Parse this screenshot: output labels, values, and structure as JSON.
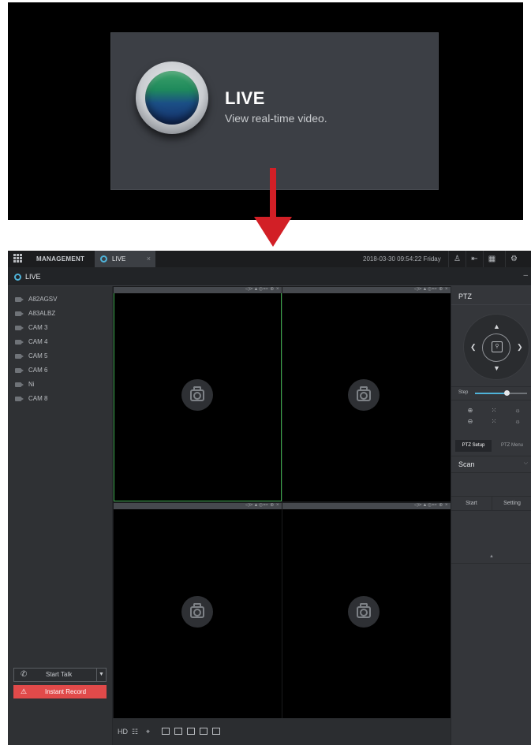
{
  "promo": {
    "title": "LIVE",
    "subtitle": "View real-time video."
  },
  "topbar": {
    "management_label": "MANAGEMENT",
    "live_tab_label": "LIVE",
    "tab_close": "×",
    "datetime": "2018-03-30 09:54:22 Friday"
  },
  "subbar": {
    "title": "LIVE",
    "minimize": "–"
  },
  "cameras": [
    "A82AGSV",
    "A83ALBZ",
    "CAM 3",
    "CAM 4",
    "CAM 5",
    "CAM 6",
    "Ni",
    "CAM 8"
  ],
  "left_panel": {
    "talk_label": "Start Talk",
    "record_label": "Instant Record"
  },
  "tiles": {
    "controls": "◁⊳▲◎⊷ ⊕ ×"
  },
  "bottombar": {
    "hd": "HD"
  },
  "ptz": {
    "title": "PTZ",
    "step_label": "Step",
    "step_value": 0.6,
    "tab_setup": "PTZ Setup",
    "tab_menu": "PTZ Menu",
    "mode": "Scan",
    "start": "Start",
    "setting": "Setting"
  },
  "colors": {
    "accent": "#4fb3d9",
    "record": "#e14a4a",
    "selected_outline": "#3aa84a",
    "arrow": "#d21f26"
  }
}
